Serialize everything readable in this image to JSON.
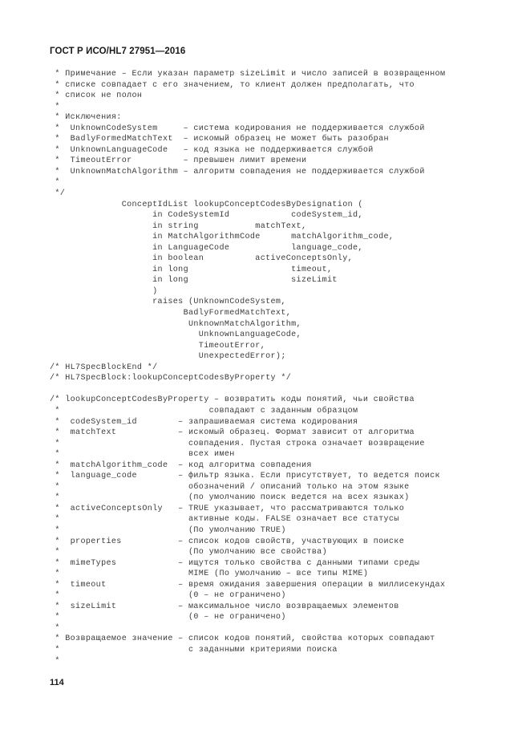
{
  "document": {
    "header": "ГОСТ Р ИСО/HL7 27951—2016",
    "page_number": "114",
    "language": "ru",
    "text_color": "#3b3b3b",
    "header_color": "#1a1a1a",
    "background_color": "#ffffff"
  },
  "code_listing": {
    "lines": [
      " * Примечание – Если указан параметр sizeLimit и число записей в возвращенном",
      " * списке совпадает с его значением, то клиент должен предполагать, что",
      " * список не полон",
      " *",
      " * Исключения:",
      " *  UnknownCodeSystem     – система кодирования не поддерживается службой",
      " *  BadlyFormedMatchText  – искомый образец не может быть разобран",
      " *  UnknownLanguageCode   – код языка не поддерживается службой",
      " *  TimeoutError          – превышен лимит времени",
      " *  UnknownMatchAlgorithm – алгоритм совпадения не поддерживается службой",
      " *",
      " */",
      "              ConceptIdList lookupConceptCodesByDesignation (",
      "                    in CodeSystemId            codeSystem_id,",
      "                    in string           matchText,",
      "                    in MatchAlgorithmCode      matchAlgorithm_code,",
      "                    in LanguageCode            language_code,",
      "                    in boolean          activeConceptsOnly,",
      "                    in long                    timeout,",
      "                    in long                    sizeLimit",
      "                    )",
      "                    raises (UnknownCodeSystem,",
      "                          BadlyFormedMatchText,",
      "                           UnknownMatchAlgorithm,",
      "                             UnknownLanguageCode,",
      "                             TimeoutError,",
      "                             UnexpectedError);",
      "/* HL7SpecBlockEnd */",
      "/* HL7SpecBlock:lookupConceptCodesByProperty */",
      "",
      "/* lookupConceptCodesByProperty – возвратить коды понятий, чьи свойства",
      " *                             совпадают с заданным образцом",
      " *  codeSystem_id        – запрашиваемая система кодирования",
      " *  matchText            – искомый образец. Формат зависит от алгоритма",
      " *                         совпадения. Пустая строка означает возвращение",
      " *                         всех имен",
      " *  matchAlgorithm_code  – код алгоритма совпадения",
      " *  language_code        – фильтр языка. Если присутствует, то ведется поиск",
      " *                         обозначений / описаний только на этом языке",
      " *                         (по умолчанию поиск ведется на всех языках)",
      " *  activeConceptsOnly   – TRUE указывает, что рассматриваются только",
      " *                         активные коды. FALSE означает все статусы",
      " *                         (По умолчанию TRUE)",
      " *  properties           – список кодов свойств, участвующих в поиске",
      " *                         (По умолчанию все свойства)",
      " *  mimeTypes            – ищутся только свойства с данными типами среды",
      " *                         MIME (По умолчанию – все типы MIME)",
      " *  timeout              – время ожидания завершения операции в миллисекундах",
      " *                         (0 – не ограничено)",
      " *  sizeLimit            – максимальное число возвращаемых элементов",
      " *                         (0 – не ограничено)",
      " *",
      " * Возвращаемое значение – список кодов понятий, свойства которых совпадают",
      " *                         с заданными критериями поиска",
      " *"
    ]
  }
}
